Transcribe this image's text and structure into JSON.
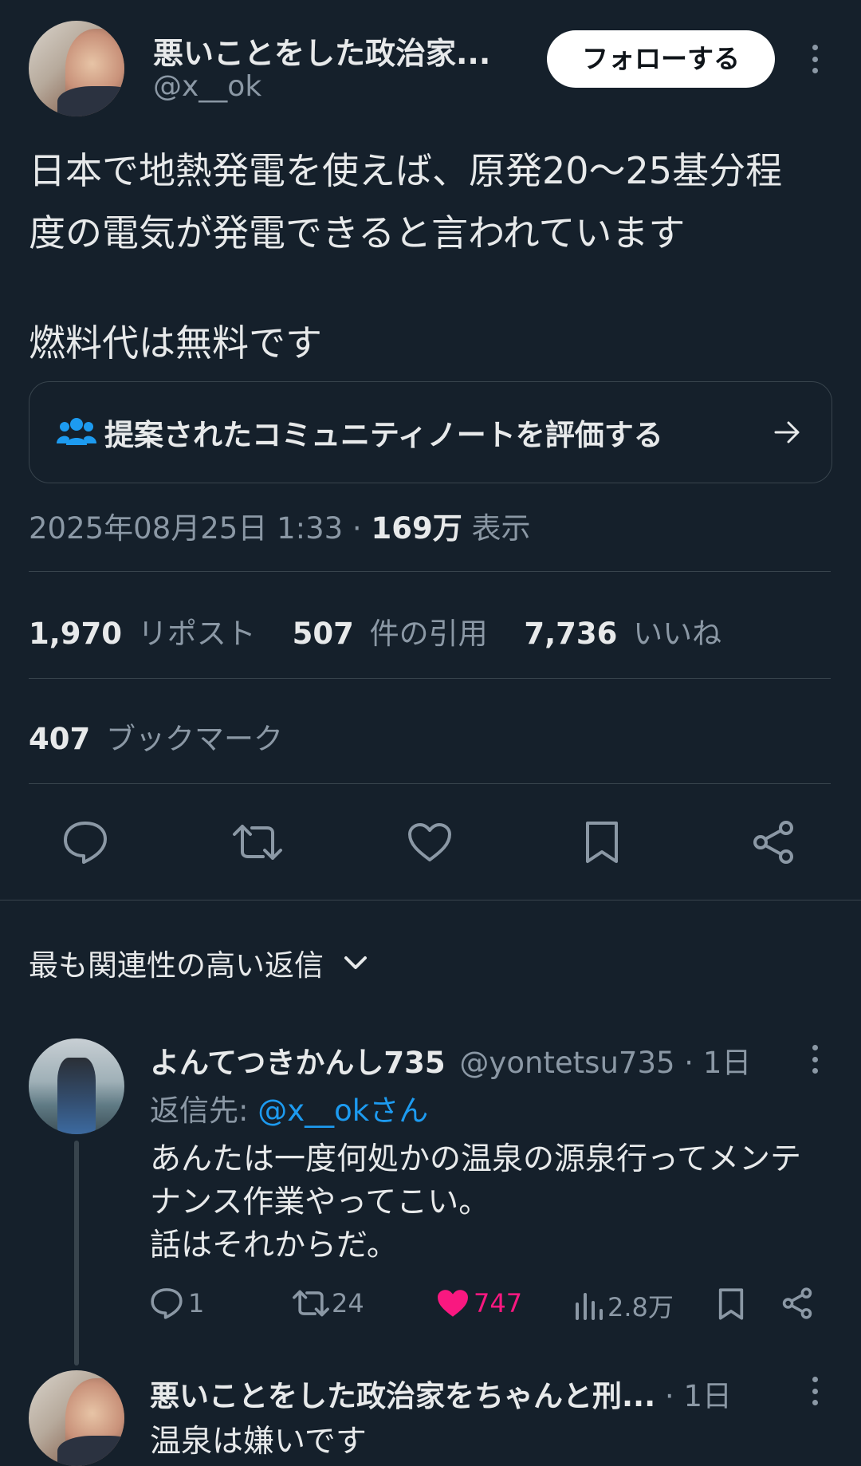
{
  "author": {
    "display_name": "悪いことをした政治家...",
    "handle": "@x__ok",
    "follow_label": "フォローする"
  },
  "tweet": {
    "line1": "日本で地熱発電を使えば、原発20〜25基分程",
    "line2": "度の電気が発電できると言われています",
    "line3": "燃料代は無料です"
  },
  "community_note": {
    "label": "提案されたコミュニティノートを評価する"
  },
  "meta": {
    "date": "2025年08月25日 1:33 · ",
    "views_count": "169万",
    "views_label": " 表示"
  },
  "stats": {
    "reposts_count": "1,970",
    "reposts_label": "リポスト",
    "quotes_count": "507",
    "quotes_label": "件の引用",
    "likes_count": "7,736",
    "likes_label": "いいね",
    "bookmarks_count": "407",
    "bookmarks_label": "ブックマーク"
  },
  "replies_sort": {
    "label": "最も関連性の高い返信"
  },
  "reply1": {
    "display_name": "よんてつきかんし735",
    "handle_time": "@yontetsu735 · 1日",
    "reply_to_prefix": "返信先: ",
    "reply_to_handle": "@x__okさん",
    "line1": "あんたは一度何処かの温泉の源泉行ってメンテ",
    "line2": "ナンス作業やってこい。",
    "line3": "話はそれからだ。",
    "replies": "1",
    "retweets": "24",
    "likes": "747",
    "views": "2.8万"
  },
  "reply2": {
    "display_name": "悪いことをした政治家をちゃんと刑...",
    "time": " · 1日",
    "text": "温泉は嫌いです"
  },
  "colors": {
    "background": "#15202b",
    "text": "#e7e9ea",
    "secondary": "#8b98a5",
    "accent": "#1d9bf0",
    "like_pink": "#f91880",
    "divider": "#38444d"
  },
  "icons": {
    "more": "more-vertical-icon",
    "community": "community-people-icon",
    "arrow": "arrow-right-icon",
    "reply": "reply-icon",
    "retweet": "retweet-icon",
    "like": "heart-icon",
    "bookmark": "bookmark-icon",
    "share": "share-icon",
    "views": "views-icon",
    "chevron": "chevron-down-icon"
  }
}
